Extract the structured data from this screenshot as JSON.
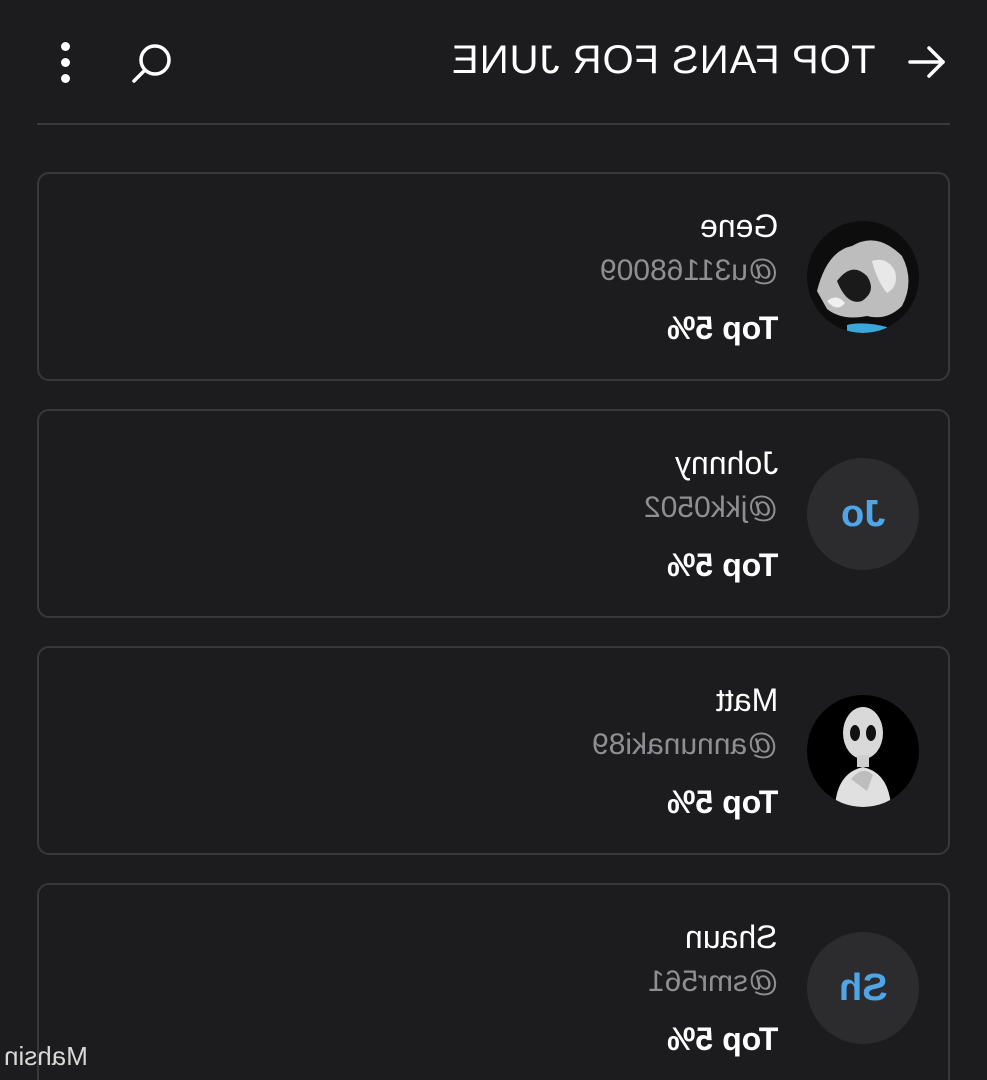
{
  "header": {
    "title": "TOP FANS FOR JUNE",
    "back_icon": "arrow-right-icon",
    "search_icon": "search-icon",
    "more_icon": "more-vertical-icon"
  },
  "fans": [
    {
      "name": "Gene",
      "handle": "@u31168009",
      "rank": "Top 5%",
      "avatar": "photo",
      "initials": ""
    },
    {
      "name": "Johnny",
      "handle": "@jkk0502",
      "rank": "Top 5%",
      "avatar": "initials",
      "initials": "Jo"
    },
    {
      "name": "Matt",
      "handle": "@annunaki89",
      "rank": "Top 5%",
      "avatar": "photo",
      "initials": ""
    },
    {
      "name": "Shaun",
      "handle": "@smr561",
      "rank": "Top 5%",
      "avatar": "initials",
      "initials": "Sh"
    }
  ],
  "watermark": "Mahsin",
  "colors": {
    "background": "#1c1c1e",
    "card_border": "#38383a",
    "initials_accent": "#4ea6e8",
    "secondary_text": "#8e8e93"
  }
}
